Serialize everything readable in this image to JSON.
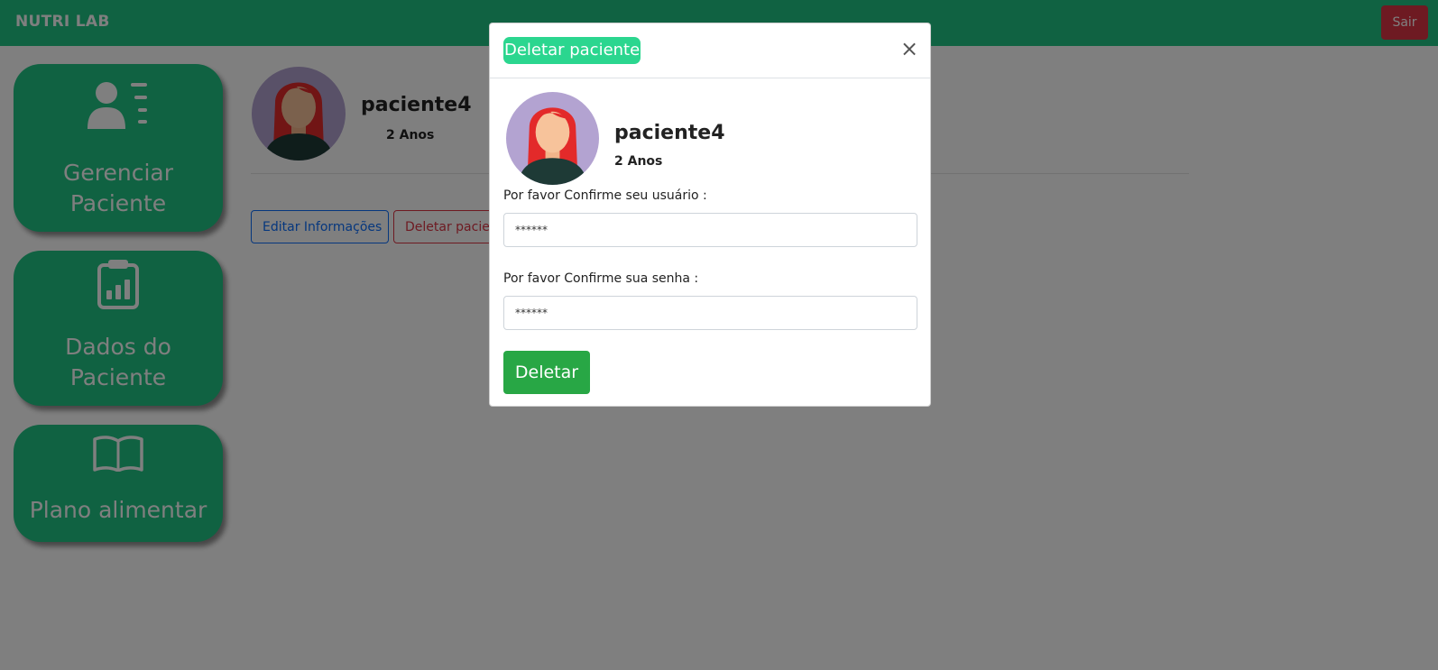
{
  "navbar": {
    "brand": "NUTRI LAB",
    "logout_label": "Sair"
  },
  "sidebar": {
    "items": [
      {
        "label": "Gerenciar Paciente",
        "icon": "user-list-icon"
      },
      {
        "label": "Dados do Paciente",
        "icon": "clipboard-chart-icon"
      },
      {
        "label": "Plano alimentar",
        "icon": "book-icon"
      }
    ]
  },
  "patient": {
    "name": "paciente4",
    "age": "2 Anos"
  },
  "actions": {
    "edit_label": "Editar Informações",
    "delete_label": "Deletar paciente"
  },
  "modal": {
    "title": "Deletar paciente",
    "close_symbol": "×",
    "patient_name": "paciente4",
    "patient_age": "2 Anos",
    "user_label": "Por favor Confirme seu usuário :",
    "user_value": "******",
    "password_label": "Por favor Confirme sua senha :",
    "password_value": "******",
    "submit_label": "Deletar"
  },
  "colors": {
    "brand_green": "#20c584",
    "danger": "#dc3545",
    "primary": "#0d6efd",
    "success": "#28a745",
    "avatar_bg": "#b3a3d1"
  }
}
